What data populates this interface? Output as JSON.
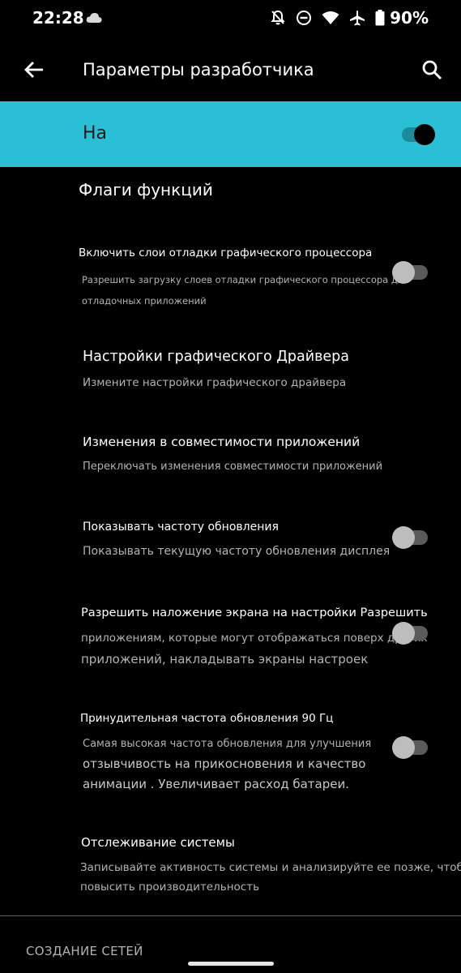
{
  "status_bar": {
    "time": "22:28",
    "battery_percent": "90%",
    "icons": [
      "cloud-icon",
      "notifications-muted-icon",
      "do-not-disturb-icon",
      "wifi-icon",
      "airplane-icon",
      "battery-icon"
    ]
  },
  "app_bar": {
    "title": "Параметры разработчика",
    "back_icon": "arrow-back-icon",
    "search_icon": "search-icon"
  },
  "master_switch": {
    "label": "На",
    "checked": true,
    "color": "#2bbfd6"
  },
  "section": {
    "title": "Флаги функций"
  },
  "items": [
    {
      "title": "Включить слои отладки графического процессора",
      "summary_lines": [
        "Разрешить загрузку слоев отладки графического процессора для",
        "отладочных приложений"
      ],
      "has_toggle": true,
      "checked": false
    },
    {
      "title": "Настройки графического Драйвера",
      "summary_lines": [
        "Измените настройки графического драйвера"
      ],
      "has_toggle": false
    },
    {
      "title": "Изменения в совместимости приложений",
      "summary_lines": [
        "Переключать изменения совместимости приложений"
      ],
      "has_toggle": false
    },
    {
      "title": "Показывать частоту обновления",
      "summary_lines": [
        "Показывать текущую частоту обновления дисплея"
      ],
      "has_toggle": true,
      "checked": false
    },
    {
      "title": "Разрешить наложение экрана на настройки Разрешить",
      "summary_lines": [
        "приложениям, которые могут отображаться поверх других",
        "приложений, накладывать экраны настроек"
      ],
      "has_toggle": true,
      "checked": false
    },
    {
      "title": "Принудительная частота обновления 90 Гц",
      "summary_lines": [
        "Самая высокая частота обновления для улучшения",
        "отзывчивость на прикосновения и качество",
        "анимации . Увеличивает расход батареи."
      ],
      "has_toggle": true,
      "checked": false
    },
    {
      "title": "Отслеживание системы",
      "summary_lines": [
        "Записывайте активность системы и анализируйте ее позже, чтобы",
        "повысить производительность"
      ],
      "has_toggle": false
    }
  ],
  "footer": {
    "category": "СОЗДАНИЕ СЕТЕЙ"
  }
}
